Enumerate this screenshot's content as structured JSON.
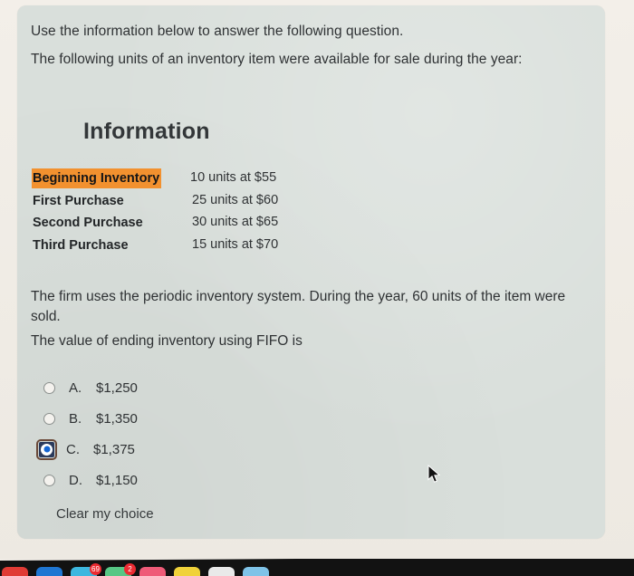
{
  "page": {
    "card_background": "#d9dfdb",
    "frame_background": "#f1ede7"
  },
  "intro": {
    "line1": "Use the information below to answer the following question.",
    "line2": "The following units of an inventory item were available for sale during the year:"
  },
  "information": {
    "heading": "Information",
    "highlight_color": "#f2912f",
    "rows": [
      {
        "label": "Beginning Inventory",
        "value": "10 units at $55",
        "highlighted": true
      },
      {
        "label": "First Purchase",
        "value": "25 units at $60",
        "highlighted": false
      },
      {
        "label": "Second Purchase",
        "value": "30 units at $65",
        "highlighted": false
      },
      {
        "label": "Third Purchase",
        "value": "15 units at $70",
        "highlighted": false
      }
    ]
  },
  "body": {
    "paragraph": "The firm uses the periodic inventory system. During the year, 60 units of the item were sold.",
    "question": "The value of ending inventory using FIFO is"
  },
  "answers": {
    "options": [
      {
        "letter": "A.",
        "text": "$1,250",
        "selected": false
      },
      {
        "letter": "B.",
        "text": "$1,350",
        "selected": false
      },
      {
        "letter": "C.",
        "text": "$1,375",
        "selected": true
      },
      {
        "letter": "D.",
        "text": "$1,150",
        "selected": false
      }
    ],
    "selected_color": "#1464d2",
    "clear_label": "Clear my choice"
  },
  "dock": {
    "icons": [
      {
        "name": "app-icon-red",
        "color": "#e03b35",
        "badge": ""
      },
      {
        "name": "app-icon-blue",
        "color": "#1f76d2",
        "badge": ""
      },
      {
        "name": "app-icon-cyan",
        "color": "#3db7df",
        "badge": "69"
      },
      {
        "name": "app-icon-green",
        "color": "#57c785",
        "badge": "2"
      },
      {
        "name": "app-icon-pink",
        "color": "#ef5b78",
        "badge": ""
      },
      {
        "name": "app-icon-yellow",
        "color": "#f0d23a",
        "badge": ""
      },
      {
        "name": "app-icon-white",
        "color": "#e9e9e9",
        "badge": ""
      },
      {
        "name": "app-icon-lightblue",
        "color": "#7fc3e8",
        "badge": ""
      }
    ]
  }
}
